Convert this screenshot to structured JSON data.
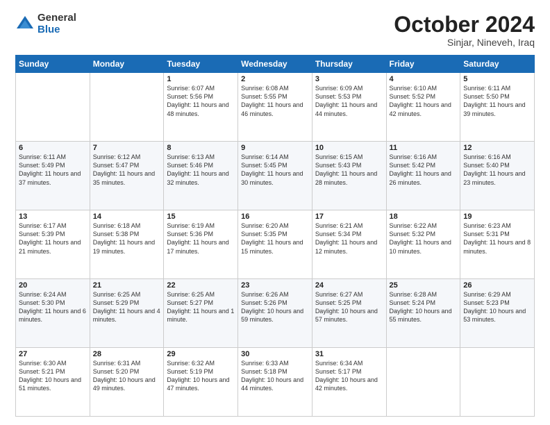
{
  "header": {
    "logo_general": "General",
    "logo_blue": "Blue",
    "month_title": "October 2024",
    "location": "Sinjar, Nineveh, Iraq"
  },
  "weekdays": [
    "Sunday",
    "Monday",
    "Tuesday",
    "Wednesday",
    "Thursday",
    "Friday",
    "Saturday"
  ],
  "weeks": [
    [
      {
        "day": "",
        "info": ""
      },
      {
        "day": "",
        "info": ""
      },
      {
        "day": "1",
        "info": "Sunrise: 6:07 AM\nSunset: 5:56 PM\nDaylight: 11 hours and 48 minutes."
      },
      {
        "day": "2",
        "info": "Sunrise: 6:08 AM\nSunset: 5:55 PM\nDaylight: 11 hours and 46 minutes."
      },
      {
        "day": "3",
        "info": "Sunrise: 6:09 AM\nSunset: 5:53 PM\nDaylight: 11 hours and 44 minutes."
      },
      {
        "day": "4",
        "info": "Sunrise: 6:10 AM\nSunset: 5:52 PM\nDaylight: 11 hours and 42 minutes."
      },
      {
        "day": "5",
        "info": "Sunrise: 6:11 AM\nSunset: 5:50 PM\nDaylight: 11 hours and 39 minutes."
      }
    ],
    [
      {
        "day": "6",
        "info": "Sunrise: 6:11 AM\nSunset: 5:49 PM\nDaylight: 11 hours and 37 minutes."
      },
      {
        "day": "7",
        "info": "Sunrise: 6:12 AM\nSunset: 5:47 PM\nDaylight: 11 hours and 35 minutes."
      },
      {
        "day": "8",
        "info": "Sunrise: 6:13 AM\nSunset: 5:46 PM\nDaylight: 11 hours and 32 minutes."
      },
      {
        "day": "9",
        "info": "Sunrise: 6:14 AM\nSunset: 5:45 PM\nDaylight: 11 hours and 30 minutes."
      },
      {
        "day": "10",
        "info": "Sunrise: 6:15 AM\nSunset: 5:43 PM\nDaylight: 11 hours and 28 minutes."
      },
      {
        "day": "11",
        "info": "Sunrise: 6:16 AM\nSunset: 5:42 PM\nDaylight: 11 hours and 26 minutes."
      },
      {
        "day": "12",
        "info": "Sunrise: 6:16 AM\nSunset: 5:40 PM\nDaylight: 11 hours and 23 minutes."
      }
    ],
    [
      {
        "day": "13",
        "info": "Sunrise: 6:17 AM\nSunset: 5:39 PM\nDaylight: 11 hours and 21 minutes."
      },
      {
        "day": "14",
        "info": "Sunrise: 6:18 AM\nSunset: 5:38 PM\nDaylight: 11 hours and 19 minutes."
      },
      {
        "day": "15",
        "info": "Sunrise: 6:19 AM\nSunset: 5:36 PM\nDaylight: 11 hours and 17 minutes."
      },
      {
        "day": "16",
        "info": "Sunrise: 6:20 AM\nSunset: 5:35 PM\nDaylight: 11 hours and 15 minutes."
      },
      {
        "day": "17",
        "info": "Sunrise: 6:21 AM\nSunset: 5:34 PM\nDaylight: 11 hours and 12 minutes."
      },
      {
        "day": "18",
        "info": "Sunrise: 6:22 AM\nSunset: 5:32 PM\nDaylight: 11 hours and 10 minutes."
      },
      {
        "day": "19",
        "info": "Sunrise: 6:23 AM\nSunset: 5:31 PM\nDaylight: 11 hours and 8 minutes."
      }
    ],
    [
      {
        "day": "20",
        "info": "Sunrise: 6:24 AM\nSunset: 5:30 PM\nDaylight: 11 hours and 6 minutes."
      },
      {
        "day": "21",
        "info": "Sunrise: 6:25 AM\nSunset: 5:29 PM\nDaylight: 11 hours and 4 minutes."
      },
      {
        "day": "22",
        "info": "Sunrise: 6:25 AM\nSunset: 5:27 PM\nDaylight: 11 hours and 1 minute."
      },
      {
        "day": "23",
        "info": "Sunrise: 6:26 AM\nSunset: 5:26 PM\nDaylight: 10 hours and 59 minutes."
      },
      {
        "day": "24",
        "info": "Sunrise: 6:27 AM\nSunset: 5:25 PM\nDaylight: 10 hours and 57 minutes."
      },
      {
        "day": "25",
        "info": "Sunrise: 6:28 AM\nSunset: 5:24 PM\nDaylight: 10 hours and 55 minutes."
      },
      {
        "day": "26",
        "info": "Sunrise: 6:29 AM\nSunset: 5:23 PM\nDaylight: 10 hours and 53 minutes."
      }
    ],
    [
      {
        "day": "27",
        "info": "Sunrise: 6:30 AM\nSunset: 5:21 PM\nDaylight: 10 hours and 51 minutes."
      },
      {
        "day": "28",
        "info": "Sunrise: 6:31 AM\nSunset: 5:20 PM\nDaylight: 10 hours and 49 minutes."
      },
      {
        "day": "29",
        "info": "Sunrise: 6:32 AM\nSunset: 5:19 PM\nDaylight: 10 hours and 47 minutes."
      },
      {
        "day": "30",
        "info": "Sunrise: 6:33 AM\nSunset: 5:18 PM\nDaylight: 10 hours and 44 minutes."
      },
      {
        "day": "31",
        "info": "Sunrise: 6:34 AM\nSunset: 5:17 PM\nDaylight: 10 hours and 42 minutes."
      },
      {
        "day": "",
        "info": ""
      },
      {
        "day": "",
        "info": ""
      }
    ]
  ]
}
